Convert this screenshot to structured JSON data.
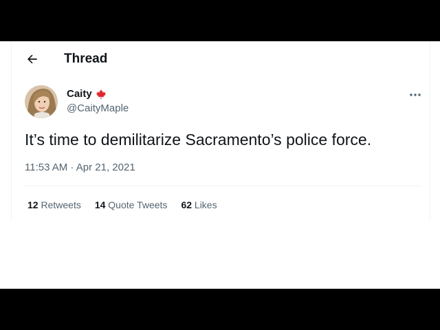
{
  "header": {
    "back_icon": "arrow-left-icon",
    "title": "Thread"
  },
  "tweet": {
    "author": {
      "name": "Caity",
      "badge_icon": "maple-leaf-icon",
      "handle": "@CaityMaple"
    },
    "more_icon": "more-horizontal-icon",
    "text": "It’s time to demilitarize Sacramento’s police force.",
    "timestamp": "11:53 AM · Apr 21, 2021",
    "stats": {
      "retweets": {
        "count": "12",
        "label": "Retweets"
      },
      "quotes": {
        "count": "14",
        "label": "Quote Tweets"
      },
      "likes": {
        "count": "62",
        "label": "Likes"
      }
    }
  },
  "colors": {
    "text_primary": "#0f1419",
    "text_secondary": "#536471",
    "maple_red": "#e0262e",
    "divider": "#eff3f4"
  }
}
